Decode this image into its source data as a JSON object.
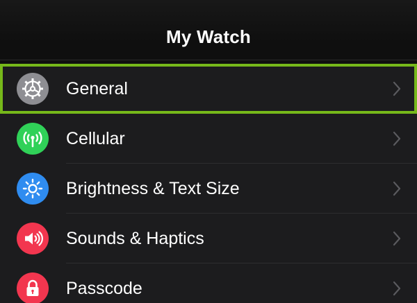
{
  "header": {
    "title": "My Watch"
  },
  "settings": {
    "items": [
      {
        "label": "General",
        "icon": "gear-icon",
        "icon_color": "#8e8e93",
        "highlighted": true
      },
      {
        "label": "Cellular",
        "icon": "antenna-icon",
        "icon_color": "#30d158",
        "highlighted": false
      },
      {
        "label": "Brightness & Text Size",
        "icon": "sun-icon",
        "icon_color": "#2f8cf0",
        "highlighted": false
      },
      {
        "label": "Sounds & Haptics",
        "icon": "speaker-icon",
        "icon_color": "#f2364f",
        "highlighted": false
      },
      {
        "label": "Passcode",
        "icon": "lock-icon",
        "icon_color": "#f2364f",
        "highlighted": false
      }
    ]
  },
  "colors": {
    "highlight_border": "#76b81a",
    "background": "#1c1c1e",
    "text": "#ffffff",
    "chevron": "#5a5a5e"
  }
}
